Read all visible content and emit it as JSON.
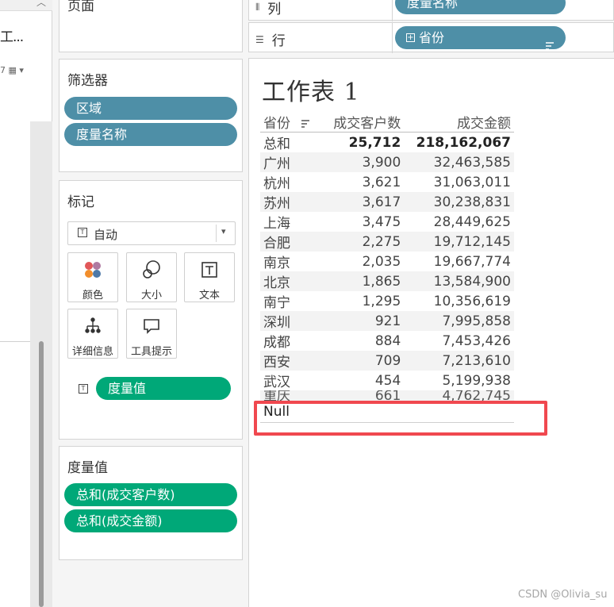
{
  "left_panel": {
    "datasource_label": "工...",
    "tools_label": "7 ▦ ▾"
  },
  "pages_card": {
    "title": "页面"
  },
  "filters_card": {
    "title": "筛选器",
    "pills": [
      "区域",
      "度量名称"
    ]
  },
  "marks_card": {
    "title": "标记",
    "mark_type": "自动",
    "buttons": [
      "颜色",
      "大小",
      "文本",
      "详细信息",
      "工具提示"
    ],
    "text_pill": "度量值"
  },
  "measure_values_card": {
    "title": "度量值",
    "pills": [
      "总和(成交客户数)",
      "总和(成交金额)"
    ]
  },
  "shelves": {
    "columns_label": "列",
    "columns_pill": "度量名称",
    "rows_label": "行",
    "rows_pill": "省份"
  },
  "worksheet": {
    "title": "工作表 1",
    "headers": [
      "省份",
      "成交客户数",
      "成交金额"
    ],
    "total_row": [
      "总和",
      "25,712",
      "218,162,067"
    ],
    "rows": [
      [
        "广州",
        "3,900",
        "32,463,585"
      ],
      [
        "杭州",
        "3,621",
        "31,063,011"
      ],
      [
        "苏州",
        "3,617",
        "30,238,831"
      ],
      [
        "上海",
        "3,475",
        "28,449,625"
      ],
      [
        "合肥",
        "2,275",
        "19,712,145"
      ],
      [
        "南京",
        "2,035",
        "19,667,774"
      ],
      [
        "北京",
        "1,865",
        "13,584,900"
      ],
      [
        "南宁",
        "1,295",
        "10,356,619"
      ],
      [
        "深圳",
        "921",
        "7,995,858"
      ],
      [
        "成都",
        "884",
        "7,453,426"
      ],
      [
        "西安",
        "709",
        "7,213,610"
      ],
      [
        "武汉",
        "454",
        "5,199,938"
      ],
      [
        "重庆",
        "661",
        "4,762,745"
      ]
    ],
    "null_row": "Null"
  },
  "colors": {
    "pill_dimension": "#4e8fa7",
    "pill_measure": "#00a878",
    "highlight": "#f0484f"
  },
  "watermark": "CSDN @Olivia_su"
}
